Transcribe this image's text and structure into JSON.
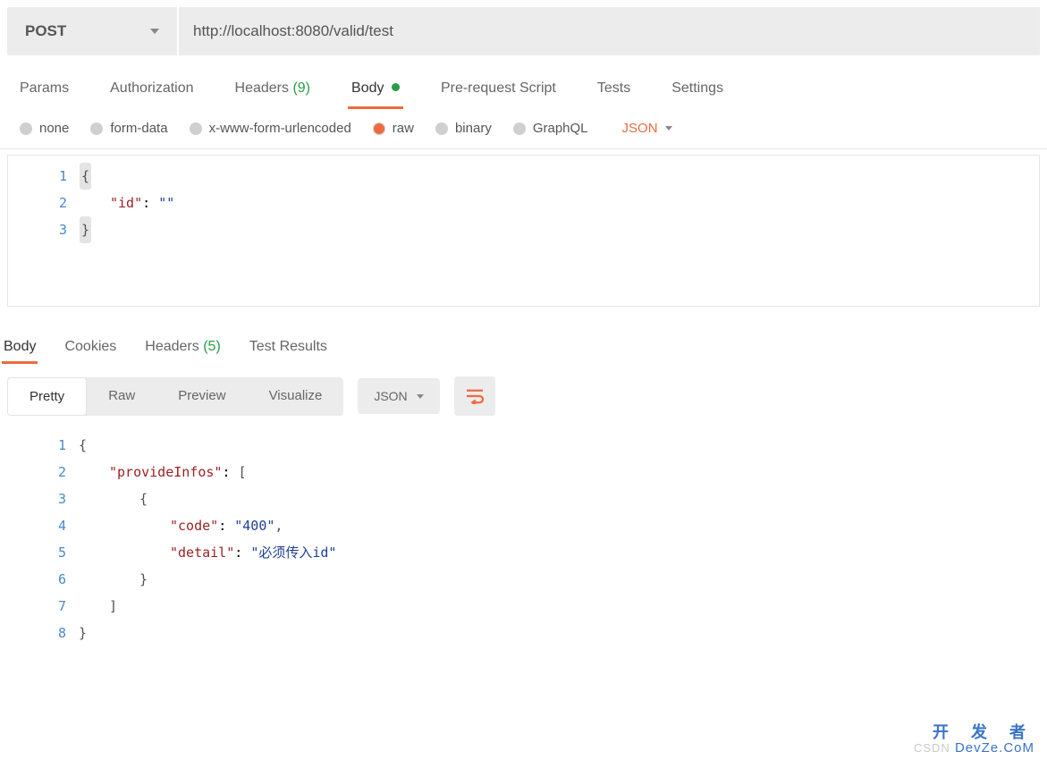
{
  "request": {
    "method": "POST",
    "url": "http://localhost:8080/valid/test"
  },
  "tabs": {
    "params": "Params",
    "auth": "Authorization",
    "headers": "Headers",
    "headers_count": "(9)",
    "body": "Body",
    "prereq": "Pre-request Script",
    "tests": "Tests",
    "settings": "Settings"
  },
  "body_types": {
    "none": "none",
    "formdata": "form-data",
    "urlenc": "x-www-form-urlencoded",
    "raw": "raw",
    "binary": "binary",
    "graphql": "GraphQL",
    "format": "JSON"
  },
  "req_body": {
    "lines": [
      "1",
      "2",
      "3"
    ],
    "key_id": "\"id\"",
    "val_id": "\"\""
  },
  "resp_tabs": {
    "body": "Body",
    "cookies": "Cookies",
    "headers": "Headers",
    "headers_count": "(5)",
    "tests": "Test Results"
  },
  "views": {
    "pretty": "Pretty",
    "raw": "Raw",
    "preview": "Preview",
    "visualize": "Visualize",
    "type": "JSON"
  },
  "resp_body": {
    "lines": [
      "1",
      "2",
      "3",
      "4",
      "5",
      "6",
      "7",
      "8"
    ],
    "k_provide": "\"provideInfos\"",
    "k_code": "\"code\"",
    "v_code": "\"400\"",
    "k_detail": "\"detail\"",
    "v_detail_p1": "\"必须传入",
    "v_detail_p2": "id\""
  },
  "watermark": {
    "top": "开 发 者",
    "bot": "DevZe.CoM",
    "csdn": "CSDN"
  }
}
